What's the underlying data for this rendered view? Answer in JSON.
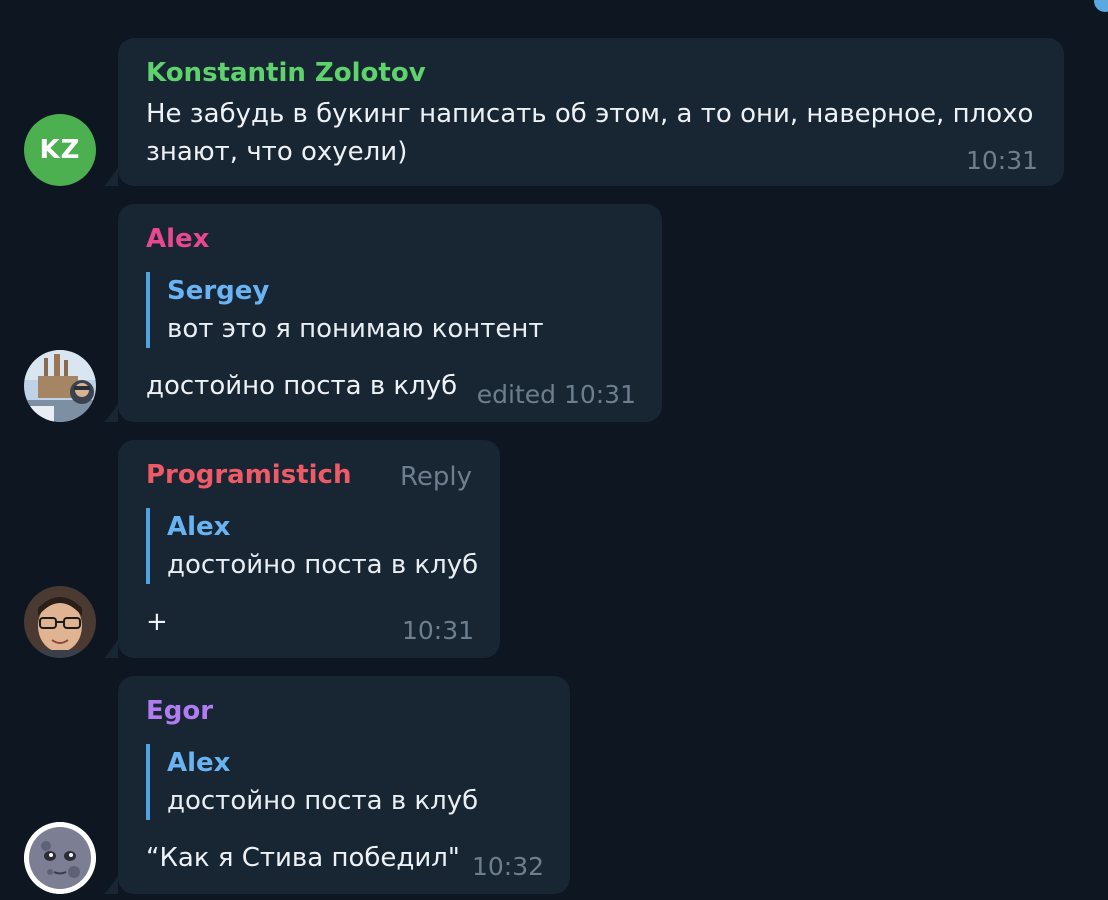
{
  "messages": [
    {
      "sender": "Konstantin Zolotov",
      "sender_color": "#5fd36b",
      "avatar_initials": "KZ",
      "text_lines": [
        "Не забудь в букинг написать об этом, а то они, наверное, плохо",
        "знают, что охуели)"
      ],
      "time": "10:31"
    },
    {
      "sender": "Alex",
      "sender_color": "#e8488e",
      "quote": {
        "author": "Sergey",
        "text": "вот это я понимаю контент"
      },
      "text": "достойно поста в клуб",
      "time": "edited 10:31"
    },
    {
      "sender": "Programistich",
      "sender_color": "#ee5a66",
      "reply_label": "Reply",
      "quote": {
        "author": "Alex",
        "text": "достойно поста в клуб"
      },
      "text": "+",
      "time": "10:31"
    },
    {
      "sender": "Egor",
      "sender_color": "#b07cf0",
      "quote": {
        "author": "Alex",
        "text": "достойно поста в клуб"
      },
      "text": "“Как я Стива победил\"",
      "time": "10:32"
    }
  ]
}
